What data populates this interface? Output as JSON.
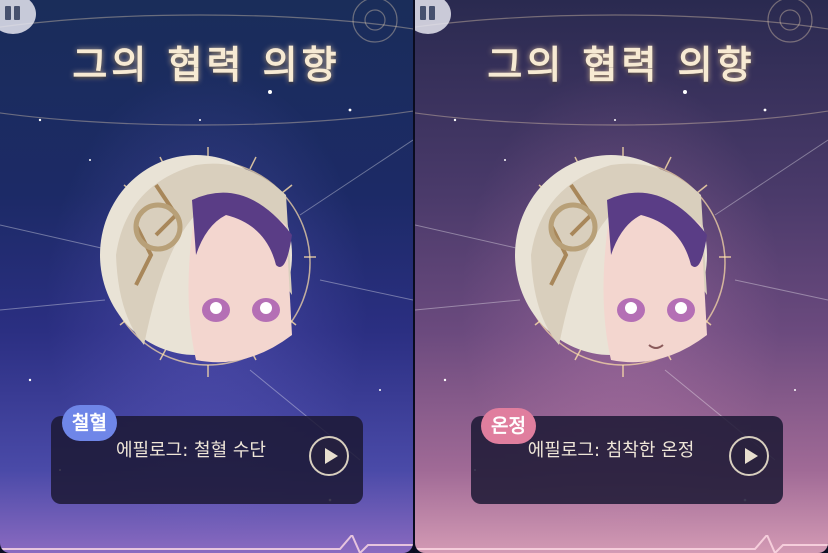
{
  "panels": [
    {
      "title": "그의 협력 의향",
      "tag": "철혈",
      "tag_color": "#6f86e8",
      "dialog": "에필로그: 철혈 수단",
      "controls": [
        "pause-icon",
        "play-icon"
      ]
    },
    {
      "title": "그의 협력 의향",
      "tag": "온정",
      "tag_color": "#e07e9e",
      "dialog": "에필로그: 침착한 온정",
      "controls": [
        "pause-icon",
        "play-icon"
      ]
    }
  ]
}
